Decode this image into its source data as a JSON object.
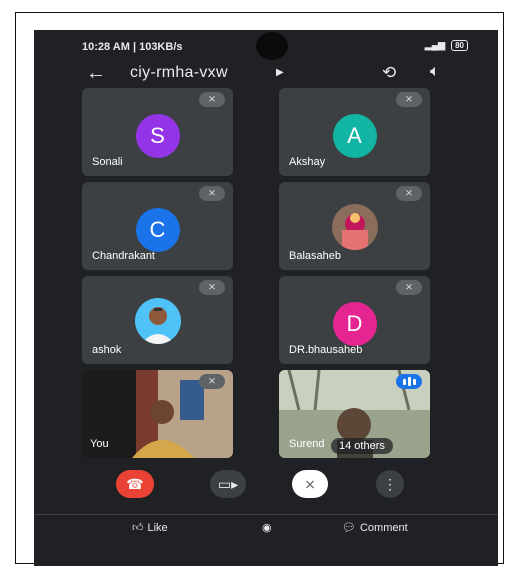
{
  "status": {
    "time": "10:28 AM | 103KB/s",
    "battery": "80"
  },
  "topbar": {
    "meeting_code": "ciy-rmha-vxw"
  },
  "participants": [
    {
      "name": "Sonali",
      "initial": "S",
      "color": "#9334e6"
    },
    {
      "name": "Akshay",
      "initial": "A",
      "color": "#12b5a4"
    },
    {
      "name": "Chandrakant",
      "initial": "C",
      "color": "#1a73e8"
    },
    {
      "name": "Balasaheb",
      "initial": "",
      "color": ""
    },
    {
      "name": "ashok",
      "initial": "",
      "color": ""
    },
    {
      "name": "DR.bhausaheb",
      "initial": "D",
      "color": "#e52592"
    },
    {
      "name": "You",
      "initial": "",
      "color": ""
    },
    {
      "name": "Surend",
      "initial": "",
      "color": ""
    }
  ],
  "others_label": "14 others",
  "controls": {
    "end_call_color": "#ea4335"
  },
  "bottom": {
    "like_label": "Like",
    "comment_label": "Comment"
  },
  "icons": [
    "back-arrow-icon",
    "switch-camera-icon",
    "speaker-icon",
    "mic-off-icon",
    "end-call-icon",
    "camera-icon",
    "more-icon",
    "like-icon",
    "comment-icon"
  ]
}
